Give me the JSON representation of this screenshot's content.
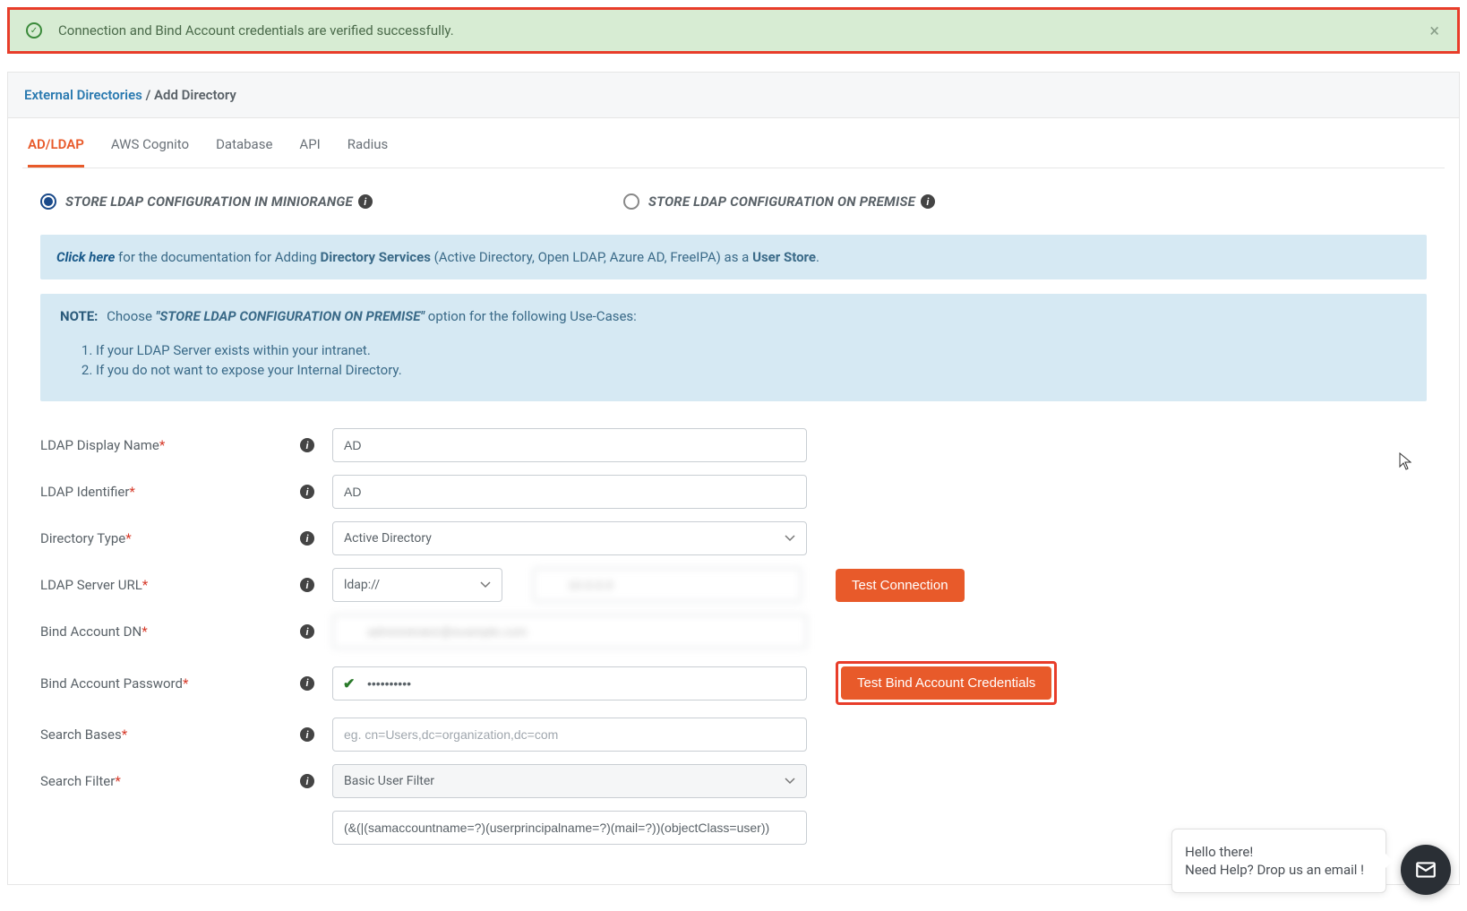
{
  "alert": {
    "message": "Connection and Bind Account credentials are verified successfully."
  },
  "breadcrumb": {
    "root": "External Directories",
    "current": "Add Directory"
  },
  "tabs": [
    "AD/LDAP",
    "AWS Cognito",
    "Database",
    "API",
    "Radius"
  ],
  "radios": {
    "miniorange": "STORE LDAP CONFIGURATION IN MINIORANGE",
    "onprem": "STORE LDAP CONFIGURATION ON PREMISE"
  },
  "help": {
    "click_here": "Click here",
    "line1_a": " for the documentation for Adding ",
    "dir_services": "Directory Services",
    "line1_b": " (Active Directory, Open LDAP, Azure AD, FreeIPA) as a ",
    "user_store": "User Store",
    "period": "."
  },
  "note": {
    "label": "NOTE:",
    "prefix": "  Choose ",
    "em": "\"STORE LDAP CONFIGURATION ON PREMISE\"",
    "suffix": " option for the following Use-Cases:",
    "items": [
      "If your LDAP Server exists within your intranet.",
      "If you do not want to expose your Internal Directory."
    ]
  },
  "form": {
    "display_name": {
      "label": "LDAP Display Name",
      "value": "AD"
    },
    "identifier": {
      "label": "LDAP Identifier",
      "value": "AD"
    },
    "dir_type": {
      "label": "Directory Type",
      "value": "Active Directory"
    },
    "server_url": {
      "label": "LDAP Server URL",
      "protocol": "ldap://",
      "host": "10.0.0.0"
    },
    "bind_dn": {
      "label": "Bind Account DN",
      "value": "administrator@example.com"
    },
    "bind_pw": {
      "label": "Bind Account Password",
      "value": "••••••••••"
    },
    "search_bases": {
      "label": "Search Bases",
      "placeholder": "eg. cn=Users,dc=organization,dc=com",
      "value": ""
    },
    "search_filter": {
      "label": "Search Filter",
      "type": "Basic User Filter",
      "query": "(&(|(samaccountname=?)(userprincipalname=?)(mail=?))(objectClass=user))"
    }
  },
  "buttons": {
    "test_conn": "Test Connection",
    "test_bind": "Test Bind Account Credentials"
  },
  "chat": {
    "line1": "Hello there!",
    "line2": "Need Help? Drop us an email !"
  }
}
